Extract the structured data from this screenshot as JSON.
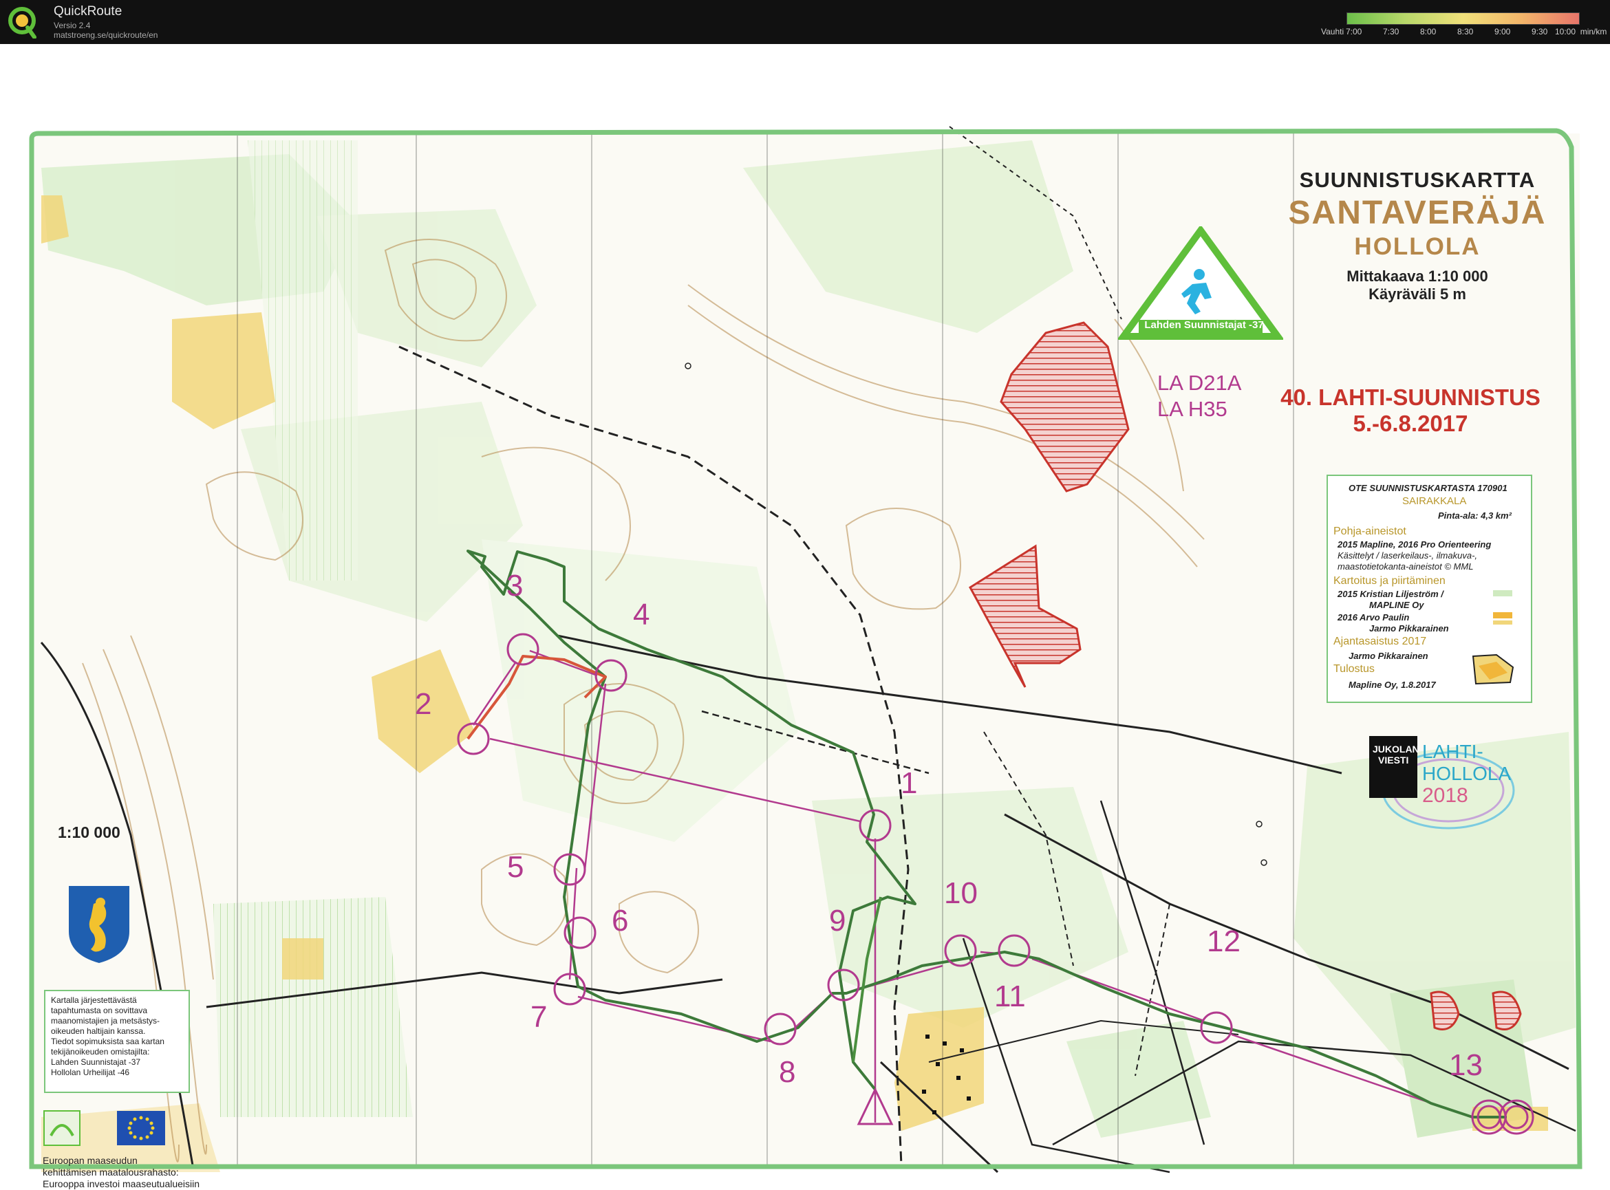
{
  "app": {
    "title": "QuickRoute",
    "version": "Versio 2.4",
    "url": "matstroeng.se/quickroute/en"
  },
  "pace_scale": {
    "caption": "Vauhti",
    "ticks": [
      "7:00",
      "7:30",
      "8:00",
      "8:30",
      "9:00",
      "9:30",
      "10:00"
    ],
    "unit": "min/km",
    "gradient_colors": [
      "#6cbf4a",
      "#b8d86a",
      "#f0e07a",
      "#f3b66a",
      "#e8756a"
    ]
  },
  "map": {
    "kind": "SUUNNISTUSKARTTA",
    "name": "SANTAVERÄJÄ",
    "place": "HOLLOLA",
    "scale_text": "Mittakaava 1:10 000",
    "contour_text": "Käyräväli 5 m",
    "event_name": "40. LAHTI-SUUNNISTUS",
    "event_dates": "5.-6.8.2017",
    "classes": [
      "LA D21A",
      "LA H35"
    ],
    "scale_left": "1:10 000",
    "club_logo_label": "Lahden Suunnistajat",
    "club_logo_suffix": "-37",
    "jukola_logo_text": [
      "JUKOLAN",
      "VIESTI"
    ],
    "jukola_logo_place": [
      "LAHTI-",
      "HOLLOLA"
    ],
    "jukola_logo_year": "2018"
  },
  "controls": [
    {
      "label": "1"
    },
    {
      "label": "2"
    },
    {
      "label": "3"
    },
    {
      "label": "4"
    },
    {
      "label": "5"
    },
    {
      "label": "6"
    },
    {
      "label": "7"
    },
    {
      "label": "8"
    },
    {
      "label": "9"
    },
    {
      "label": "10"
    },
    {
      "label": "11"
    },
    {
      "label": "12"
    },
    {
      "label": "13"
    }
  ],
  "info_box": {
    "header": "OTE SUUNNISTUSKARTASTA 170901",
    "area_name": "SAIRAKKALA",
    "area_size": "Pinta-ala: 4,3 km²",
    "sections": [
      {
        "title": "Pohja-aineistot",
        "items": [
          "2015 Mapline, 2016 Pro Orienteering",
          "Käsittelyt / laserkeilaus-, ilmakuva-,",
          "maastotietokanta-aineistot  © MML"
        ]
      },
      {
        "title": "Kartoitus ja piirtäminen",
        "items": [
          "2015 Kristian Liljeström /",
          "MAPLINE Oy",
          "2016 Arvo Paulin",
          "Jarmo Pikkarainen"
        ]
      },
      {
        "title": "Ajantasaistus 2017",
        "items": [
          "Jarmo Pikkarainen"
        ]
      },
      {
        "title": "Tulostus",
        "items": [
          "Mapline Oy, 1.8.2017"
        ]
      }
    ]
  },
  "notice": "Kartalla järjestettävästä\ntapahtumasta on sovittava\nmaanomistajien ja metsästys-\noikeuden haltijain kanssa.\nTiedot sopimuksista saa kartan\ntekijänoikeuden omistajilta:\nLahden Suunnistajat -37\nHollolan Urheilijat -46",
  "eu_text": "Euroopan maaseudun\nkehittämisen maatalousrahasto:\nEurooppa investoi maaseutualueisiin",
  "colors": {
    "course": "#b23a8e",
    "route": "#3d7a3a",
    "frame": "#7bc67b",
    "contour": "#b5874a",
    "yellow_open": "#f1d67a",
    "green_vegetation": "#cfeac0",
    "forbidden": "#c8342c"
  }
}
